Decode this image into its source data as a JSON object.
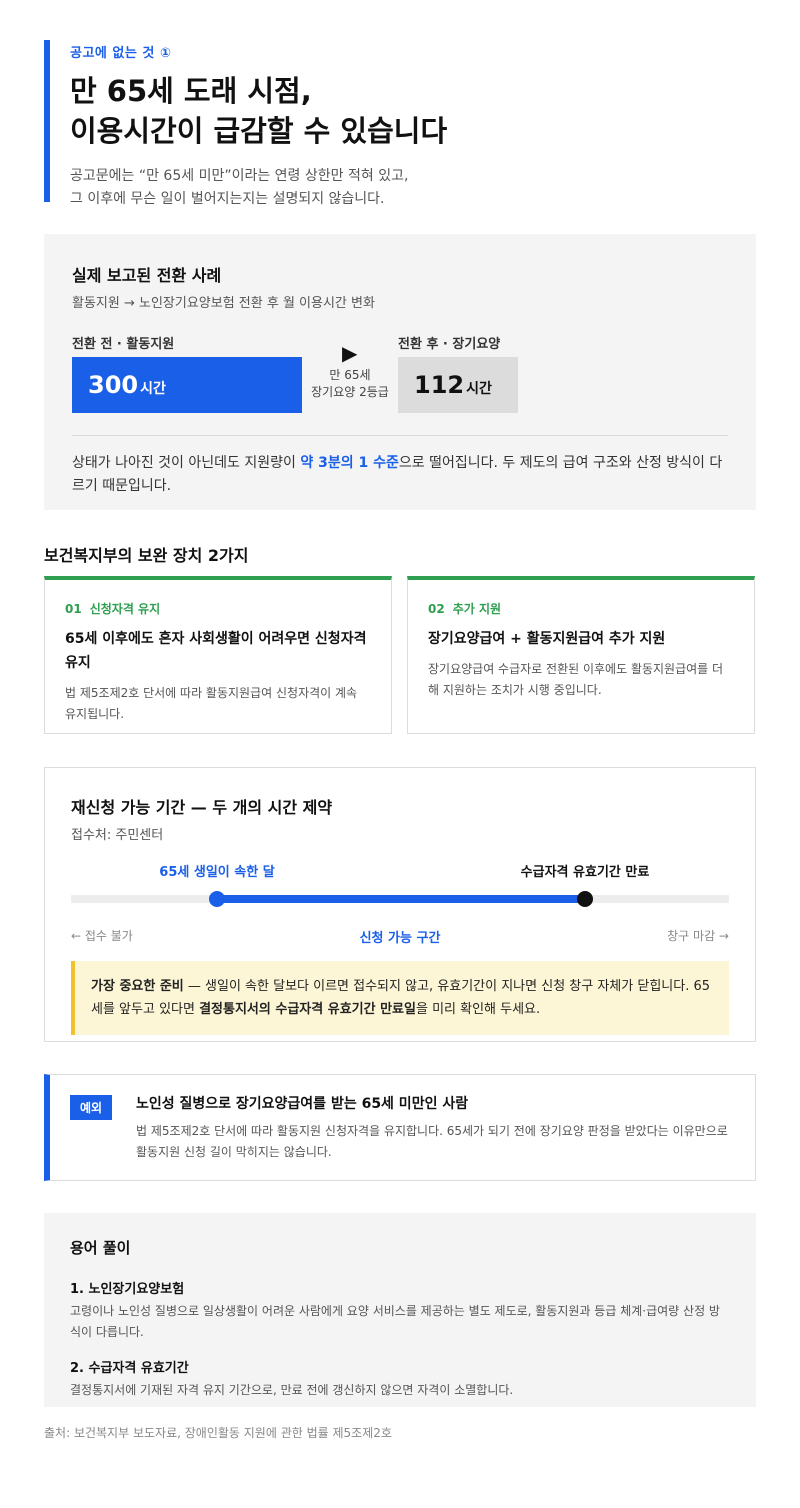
{
  "header": {
    "eyebrow": "공고에 없는 것 ①",
    "title_line1": "만 65세 도래 시점,",
    "title_line2": "이용시간이 급감할 수 있습니다",
    "subtitle_line1": "공고문에는 “만 65세 미만”이라는 연령 상한만 적혀 있고,",
    "subtitle_line2": "그 이후에 무슨 일이 벌어지는지는 설명되지 않습니다."
  },
  "case": {
    "title": "실제 보고된 전환 사례",
    "subtitle": "활동지원 → 노인장기요양보험 전환 후 월 이용시간 변화",
    "before_label": "전환 전 · 활동지원",
    "before_value": "300",
    "after_label": "전환 후 · 장기요양",
    "after_value": "112",
    "unit": "시간",
    "arrow": "▶",
    "transition_line1": "만 65세",
    "transition_line2": "장기요양 2등급",
    "note_pre": "상태가 나아진 것이 아닌데도 지원량이 ",
    "note_highlight": "약 3분의 1 수준",
    "note_post": "으로 떨어집니다. 두 제도의 급여 구조와 산정 방식이 다르기 때문입니다."
  },
  "measures": {
    "section_title": "보건복지부의 보완 장치 2가지",
    "cards": [
      {
        "num": "01",
        "tag": "신청자격 유지",
        "title": "65세 이후에도 혼자 사회생활이 어려우면 신청자격 유지",
        "desc": "법 제5조제2호 단서에 따라 활동지원급여 신청자격이 계속 유지됩니다."
      },
      {
        "num": "02",
        "tag": "추가 지원",
        "title": "장기요양급여 + 활동지원급여 추가 지원",
        "desc": "장기요양급여 수급자로 전환된 이후에도 활동지원급여를 더해 지원하는 조치가 시행 중입니다."
      }
    ]
  },
  "window": {
    "title": "재신청 가능 기간 — 두 개의 시간 제약",
    "subtitle": "접수처: 주민센터",
    "start_label": "65세 생일이 속한 달",
    "end_label": "수급자격 유효기간 만료",
    "left_note": "← 접수 불가",
    "mid_note": "신청 가능 구간",
    "right_note": "창구 마감 →",
    "warn_lead": "가장 중요한 준비",
    "warn_text1": " — 생일이 속한 달보다 이르면 접수되지 않고, 유효기간이 지나면 신청 창구 자체가 닫힙니다. 65세를 앞두고 있다면 ",
    "warn_bold": "결정통지서의 수급자격 유효기간 만료일",
    "warn_text2": "을 미리 확인해 두세요."
  },
  "exception": {
    "badge": "예외",
    "title": "노인성 질병으로 장기요양급여를 받는 65세 미만인 사람",
    "desc": "법 제5조제2호 단서에 따라 활동지원 신청자격을 유지합니다. 65세가 되기 전에 장기요양 판정을 받았다는 이유만으로 활동지원 신청 길이 막히지는 않습니다."
  },
  "glossary": {
    "title": "용어 풀이",
    "items": [
      {
        "term": "1. 노인장기요양보험",
        "desc": "고령이나 노인성 질병으로 일상생활이 어려운 사람에게 요양 서비스를 제공하는 별도 제도로, 활동지원과 등급 체계·급여량 산정 방식이 다릅니다."
      },
      {
        "term": "2. 수급자격 유효기간",
        "desc": "결정통지서에 기재된 자격 유지 기간으로, 만료 전에 갱신하지 않으면 자격이 소멸합니다."
      }
    ]
  },
  "source": "출처: 보건복지부 보도자료, 장애인활동 지원에 관한 법률 제5조제2호",
  "colors": {
    "accent": "#1a5fe8",
    "green": "#2e9e4f",
    "warn_bg": "#fdf6d6",
    "warn_border": "#f2c12e"
  }
}
